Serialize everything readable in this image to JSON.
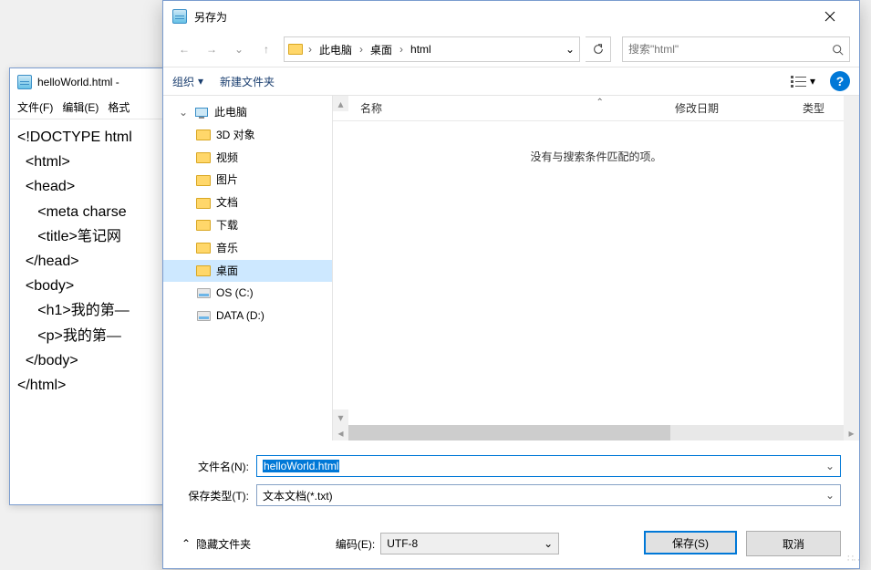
{
  "notepad": {
    "title": "helloWorld.html -",
    "menu": [
      "文件(F)",
      "编辑(E)",
      "格式"
    ],
    "content": "<!DOCTYPE html\n  <html>\n  <head>\n     <meta charse\n     <title>笔记网\n  </head>\n  <body>\n     <h1>我的第—\n     <p>我的第—\n  </body>\n</html>"
  },
  "dialog": {
    "title": "另存为",
    "nav": {
      "back": "←",
      "forward": "→",
      "up": "↑"
    },
    "breadcrumb": [
      "此电脑",
      "桌面",
      "html"
    ],
    "search_placeholder": "搜索\"html\"",
    "toolbar": {
      "organize": "组织",
      "new_folder": "新建文件夹"
    },
    "tree": [
      {
        "label": "此电脑",
        "icon": "pc",
        "expanded": true,
        "level": 0
      },
      {
        "label": "3D 对象",
        "icon": "folder",
        "level": 1
      },
      {
        "label": "视频",
        "icon": "folder",
        "level": 1
      },
      {
        "label": "图片",
        "icon": "folder",
        "level": 1
      },
      {
        "label": "文档",
        "icon": "folder",
        "level": 1
      },
      {
        "label": "下载",
        "icon": "folder",
        "level": 1
      },
      {
        "label": "音乐",
        "icon": "folder",
        "level": 1
      },
      {
        "label": "桌面",
        "icon": "folder",
        "level": 1,
        "selected": true
      },
      {
        "label": "OS (C:)",
        "icon": "disk",
        "level": 1
      },
      {
        "label": "DATA (D:)",
        "icon": "disk",
        "level": 1
      }
    ],
    "columns": {
      "name": "名称",
      "modified": "修改日期",
      "type": "类型"
    },
    "empty_msg": "没有与搜索条件匹配的项。",
    "filename_label": "文件名(N):",
    "filename_value": "helloWorld.html",
    "filetype_label": "保存类型(T):",
    "filetype_value": "文本文档(*.txt)",
    "encoding_label": "编码(E):",
    "encoding_value": "UTF-8",
    "hide_folders": "隐藏文件夹",
    "save_btn": "保存(S)",
    "cancel_btn": "取消"
  }
}
